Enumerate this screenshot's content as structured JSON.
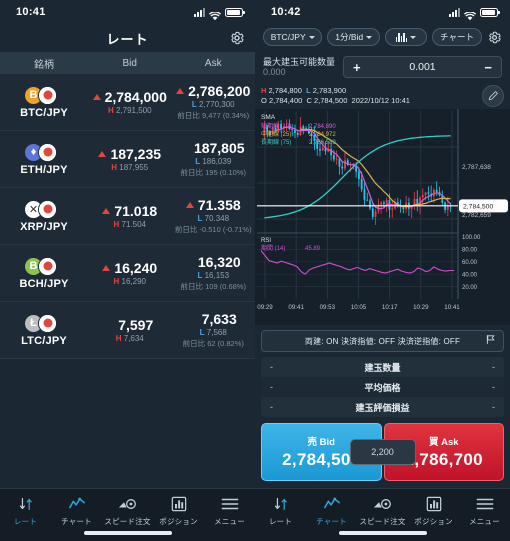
{
  "left": {
    "status": {
      "time": "10:41"
    },
    "title": "レート",
    "settings_icon": "gear-icon",
    "table": {
      "headers": {
        "symbol": "銘柄",
        "bid": "Bid",
        "ask": "Ask"
      },
      "rows": [
        {
          "symbol": "BTC/JPY",
          "coin": "B",
          "coin_color": "#f2a227",
          "bid": "2,784,000",
          "bid_up": true,
          "bid_sub_label": "H",
          "bid_sub": "2,791,500",
          "ask": "2,786,200",
          "ask_up": true,
          "ask_sub_label": "L",
          "ask_sub": "2,770,300",
          "change": "前日比 9,477 (0.34%)"
        },
        {
          "symbol": "ETH/JPY",
          "coin": "♦",
          "coin_color": "#5b76d8",
          "bid": "187,235",
          "bid_up": true,
          "bid_sub_label": "H",
          "bid_sub": "187,955",
          "ask": "187,805",
          "ask_up": false,
          "ask_sub_label": "L",
          "ask_sub": "186,039",
          "change": "前日比 195 (0.10%)"
        },
        {
          "symbol": "XRP/JPY",
          "coin": "✕",
          "coin_color": "#ffffff",
          "bid": "71.018",
          "bid_up": true,
          "bid_sub_label": "H",
          "bid_sub": "71.504",
          "ask": "71.358",
          "ask_up": true,
          "ask_sub_label": "L",
          "ask_sub": "70.348",
          "change": "前日比 -0.510 (-0.71%)"
        },
        {
          "symbol": "BCH/JPY",
          "coin": "B",
          "coin_color": "#8dc351",
          "bid": "16,240",
          "bid_up": true,
          "bid_sub_label": "H",
          "bid_sub": "16,290",
          "ask": "16,320",
          "ask_up": false,
          "ask_sub_label": "L",
          "ask_sub": "16,153",
          "change": "前日比 109 (0.68%)"
        },
        {
          "symbol": "LTC/JPY",
          "coin": "Ł",
          "coin_color": "#bdbdbd",
          "bid": "7,597",
          "bid_up": false,
          "bid_sub_label": "H",
          "bid_sub": "7,634",
          "ask": "7,633",
          "ask_up": false,
          "ask_sub_label": "L",
          "ask_sub": "7,568",
          "change": "前日比 62 (0.82%)"
        }
      ]
    },
    "tabs": [
      {
        "label": "レート",
        "icon": "rate-arrows-icon",
        "active": true
      },
      {
        "label": "チャート",
        "icon": "chart-line-icon",
        "active": false
      },
      {
        "label": "スピード注文",
        "icon": "speed-order-icon",
        "active": false
      },
      {
        "label": "ポジション",
        "icon": "position-bars-icon",
        "active": false
      },
      {
        "label": "メニュー",
        "icon": "hamburger-menu-icon",
        "active": false
      }
    ]
  },
  "right": {
    "status": {
      "time": "10:42"
    },
    "toolbar": {
      "symbol": "BTC/JPY",
      "interval": "1分/Bid",
      "chart_type_icon": "candlestick-icon",
      "chart_button": "チャート",
      "settings_icon": "gear-icon"
    },
    "order": {
      "max_label": "最大建玉可能数量",
      "max_value": "0.000",
      "minus": "−",
      "plus": "+",
      "quantity": "0.001",
      "edit_icon": "pencil-icon"
    },
    "ohlc": {
      "h_label": "H",
      "h": "2,784,800",
      "l_label": "L",
      "l": "2,783,900",
      "o_label": "O",
      "o": "2,784,400",
      "c_label": "C",
      "c": "2,784,500",
      "timestamp": "2022/10/12 10:41"
    },
    "settings_strip": {
      "text": "両建: ON  決済指値: OFF  決済逆指値: OFF",
      "icon": "flag-icon"
    },
    "position_rows": [
      {
        "left": "-",
        "label": "建玉数量",
        "right": "-"
      },
      {
        "left": "-",
        "label": "平均価格",
        "right": "-"
      },
      {
        "left": "-",
        "label": "建玉評価損益",
        "right": "-"
      }
    ],
    "trade": {
      "bid_label": "売 Bid",
      "bid_price": "2,784,500",
      "spread": "2,200",
      "ask_label": "買 Ask",
      "ask_price": "2,786,700"
    },
    "tabs": [
      {
        "label": "レート",
        "icon": "rate-arrows-icon",
        "active": false
      },
      {
        "label": "チャート",
        "icon": "chart-line-icon",
        "active": true
      },
      {
        "label": "スピード注文",
        "icon": "speed-order-icon",
        "active": false
      },
      {
        "label": "ポジション",
        "icon": "position-bars-icon",
        "active": false
      },
      {
        "label": "メニュー",
        "icon": "hamburger-menu-icon",
        "active": false
      }
    ]
  },
  "chart_data": {
    "type": "line",
    "title": "BTC/JPY 1分 Bid",
    "xlabel": "",
    "ylabel": "",
    "grid": true,
    "legend_position": "top-left",
    "price_axis": {
      "ticks": [
        "2,787,638",
        "2,782,659"
      ],
      "current_price_marker": "2,784,500"
    },
    "time_ticks": [
      "09:29",
      "09:41",
      "09:53",
      "10:05",
      "10:17",
      "10:29",
      "10:41"
    ],
    "indicators": {
      "title": "SMA",
      "series": [
        {
          "name": "短期線",
          "period": "(10)",
          "value": "2,784,890",
          "color": "#d65fd6"
        },
        {
          "name": "中期線",
          "period": "(25)",
          "value": "2,784,972",
          "color": "#d2b44b"
        },
        {
          "name": "長期線",
          "period": "(75)",
          "value": "2,786,589",
          "color": "#34cfc8"
        }
      ]
    },
    "rsi": {
      "title": "RSI",
      "param_label": "期間",
      "period": "(14)",
      "value": "45.89",
      "color": "#cf4fcf",
      "ticks": [
        "100.00",
        "80.00",
        "60.00",
        "40.00",
        "20.00"
      ],
      "ylim": [
        0,
        100
      ],
      "values": [
        78,
        70,
        62,
        60,
        58,
        61,
        59,
        57,
        55,
        52,
        44,
        40,
        47,
        50,
        52,
        54,
        56,
        58,
        56,
        54,
        52,
        49,
        47,
        49,
        51,
        48,
        46,
        49,
        47,
        45,
        43,
        42,
        44,
        46,
        48,
        45,
        43,
        42,
        44,
        50,
        48,
        44,
        46,
        52,
        48,
        46,
        45,
        46,
        46
      ]
    },
    "candles_note": "1-minute candlesticks, red up / cyan down, ~70 bars"
  }
}
